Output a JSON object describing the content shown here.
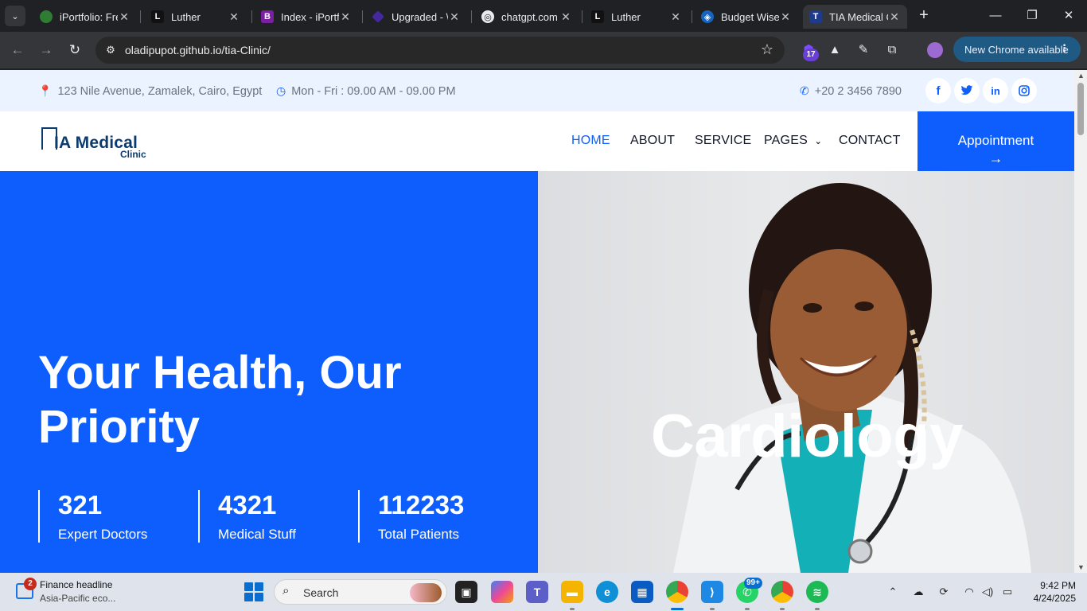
{
  "browser": {
    "tabs": [
      {
        "title": "iPortfolio: Fre",
        "favicon_color": "#2e7d32",
        "favicon_text": ""
      },
      {
        "title": "Luther",
        "favicon_color": "#111111",
        "favicon_text": "L"
      },
      {
        "title": "Index - iPortfo",
        "favicon_color": "#7b1fa2",
        "favicon_text": "B"
      },
      {
        "title": "Upgraded - \\",
        "favicon_color": "#4527a0",
        "favicon_text": ""
      },
      {
        "title": "chatgpt.com",
        "favicon_color": "#444444",
        "favicon_text": "◎"
      },
      {
        "title": "Luther",
        "favicon_color": "#111111",
        "favicon_text": "L"
      },
      {
        "title": "Budget Wise",
        "favicon_color": "#1565c0",
        "favicon_text": "◈"
      },
      {
        "title": "TIA Medical C",
        "favicon_color": "#1e3a8a",
        "favicon_text": "T"
      }
    ],
    "url": "oladipupot.github.io/tia-Clinic/",
    "extension_badge": "17",
    "update_chip": "New Chrome available"
  },
  "topbar": {
    "address": "123 Nile Avenue, Zamalek, Cairo, Egypt",
    "hours": "Mon - Fri : 09.00 AM - 09.00 PM",
    "phone": "+20 2 3456 7890",
    "social": [
      "f",
      "t",
      "in",
      "ig"
    ]
  },
  "logo": {
    "main": "IA Medical",
    "sub": "Clinic"
  },
  "nav": {
    "items": [
      {
        "label": "HOME"
      },
      {
        "label": "ABOUT"
      },
      {
        "label": "SERVICE"
      },
      {
        "label": "PAGES"
      },
      {
        "label": "CONTACT"
      }
    ],
    "appointment": "Appointment",
    "appointment_arrow": "→"
  },
  "hero": {
    "title": "Your Health, Our Priority",
    "caption": "Cardiology",
    "stats": [
      {
        "value": "321",
        "label": "Expert Doctors"
      },
      {
        "value": "4321",
        "label": "Medical Stuff"
      },
      {
        "value": "112233",
        "label": "Total Patients"
      }
    ]
  },
  "taskbar": {
    "news_badge": "2",
    "news_title": "Finance headline",
    "news_sub": "Asia-Pacific eco...",
    "search_text": "Search",
    "whatsapp_badge": "99+",
    "time": "9:42 PM",
    "date": "4/24/2025"
  },
  "colors": {
    "brand_blue": "#0d5efc",
    "logo_navy": "#0b3a6e"
  }
}
